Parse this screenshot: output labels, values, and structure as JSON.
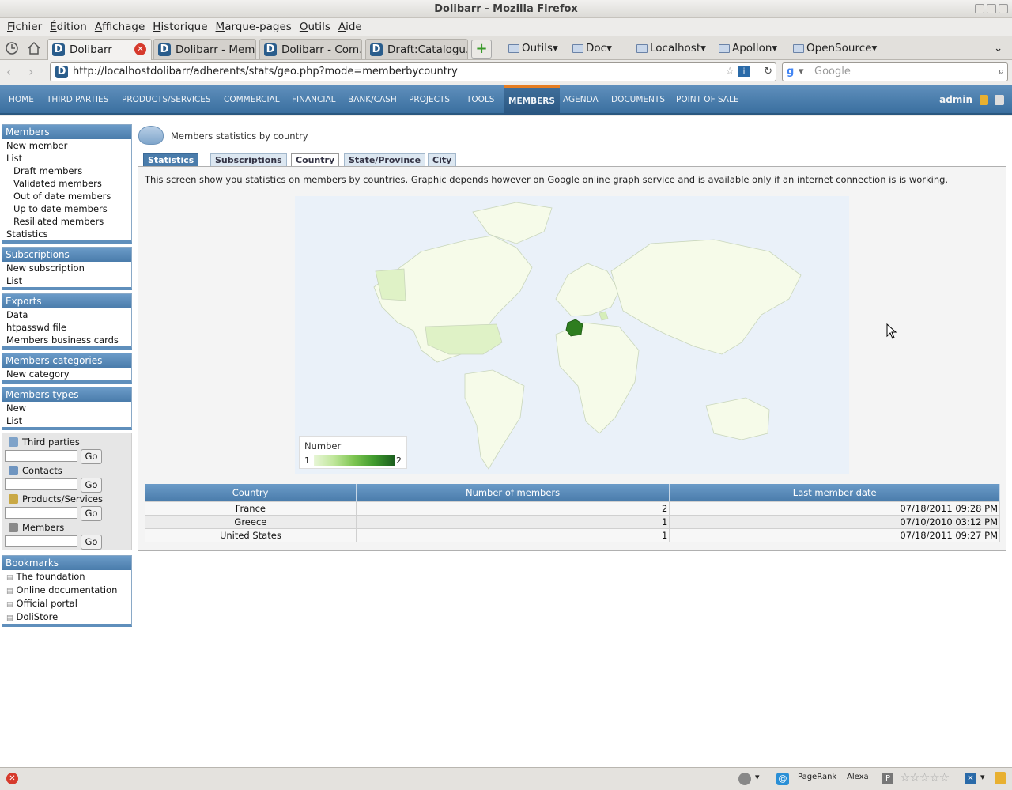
{
  "window": {
    "title": "Dolibarr - Mozilla Firefox"
  },
  "menubar": [
    "Fichier",
    "Édition",
    "Affichage",
    "Historique",
    "Marque-pages",
    "Outils",
    "Aide"
  ],
  "tabs": [
    {
      "label": "Dolibarr"
    },
    {
      "label": "Dolibarr - Mem..."
    },
    {
      "label": "Dolibarr - Com..."
    },
    {
      "label": "Draft:Catalogu..."
    }
  ],
  "bookmarks": [
    "Outils",
    "Doc",
    "Localhost",
    "Apollon",
    "OpenSource"
  ],
  "url": "http://localhostdolibarr/adherents/stats/geo.php?mode=memberbycountry",
  "search_placeholder": "Google",
  "topnav": {
    "items": [
      "HOME",
      "THIRD PARTIES",
      "PRODUCTS/SERVICES",
      "COMMERCIAL",
      "FINANCIAL",
      "BANK/CASH",
      "PROJECTS",
      "TOOLS",
      "MEMBERS",
      "AGENDA",
      "DOCUMENTS",
      "POINT OF SALE"
    ],
    "active": "MEMBERS",
    "user": "admin"
  },
  "leftmenu": {
    "members": {
      "title": "Members",
      "items": [
        "New member",
        "List",
        "Draft members",
        "Validated members",
        "Out of date members",
        "Up to date members",
        "Resiliated members",
        "Statistics"
      ]
    },
    "subscriptions": {
      "title": "Subscriptions",
      "items": [
        "New subscription",
        "List"
      ]
    },
    "exports": {
      "title": "Exports",
      "items": [
        "Data",
        "htpasswd file",
        "Members business cards"
      ]
    },
    "categories": {
      "title": "Members categories",
      "items": [
        "New category"
      ]
    },
    "types": {
      "title": "Members types",
      "items": [
        "New",
        "List"
      ]
    },
    "search": {
      "labels": [
        "Third parties",
        "Contacts",
        "Products/Services",
        "Members"
      ],
      "go": "Go"
    },
    "bookmarks": {
      "title": "Bookmarks",
      "items": [
        "The foundation",
        "Online documentation",
        "Official portal",
        "DoliStore"
      ]
    }
  },
  "page": {
    "title": "Members statistics by country",
    "tabs": [
      "Statistics",
      "Subscriptions",
      "Country",
      "State/Province",
      "City"
    ],
    "active_tab": "Country",
    "description": "This screen show you statistics on members by countries. Graphic depends however on Google online graph service and is available only if an internet connection is is working.",
    "legend": {
      "title": "Number",
      "min": "1",
      "max": "2"
    },
    "table": {
      "headers": [
        "Country",
        "Number of members",
        "Last member date"
      ],
      "rows": [
        {
          "country": "France",
          "count": "2",
          "date": "07/18/2011 09:28 PM"
        },
        {
          "country": "Greece",
          "count": "1",
          "date": "07/10/2010 03:12 PM"
        },
        {
          "country": "United States",
          "count": "1",
          "date": "07/18/2011 09:27 PM"
        }
      ]
    }
  },
  "statusbar": {
    "pagerank": "PageRank",
    "alexa": "Alexa"
  },
  "colors": {
    "nav": "#4a7cab",
    "accent": "#e67e22",
    "map_high": "#2e7d1f",
    "map_low": "#e8f6d7"
  }
}
